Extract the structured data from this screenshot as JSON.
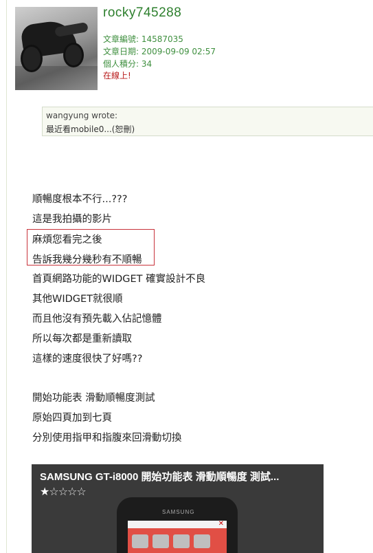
{
  "post": {
    "username": "rocky745288",
    "article_no_label": "文章編號: ",
    "article_no": "14587035",
    "date_label": "文章日期: ",
    "date": "2009-09-09 02:57",
    "points_label": "個人積分: ",
    "points": "34",
    "status": "在線上!"
  },
  "quote": {
    "author_line": "wangyung wrote:",
    "text": "最近看mobile0...(恕刪)"
  },
  "body_lines": [
    "順暢度根本不行...???",
    "這是我拍攝的影片",
    "麻煩您看完之後",
    "告訴我幾分幾秒有不順暢",
    "首頁網路功能的WIDGET 確實設計不良",
    "其他WIDGET就很順",
    "而且他沒有預先載入佔記憶體",
    "所以每次都是重新讀取",
    "這樣的速度很快了好嗎??",
    "開始功能表 滑動順暢度測試",
    "原始四頁加到七頁",
    "分別使用指甲和指腹來回滑動切換"
  ],
  "video": {
    "title": "SAMSUNG GT-i8000  開始功能表 滑動順暢度 測試...",
    "rating_stars": 1,
    "rating_max": 5,
    "phone_brand": "SAMSUNG"
  },
  "colors": {
    "username": "#2d7f2d",
    "meta": "#3f8f3f",
    "online": "#b81b1b",
    "highlight_border": "#c8323a"
  }
}
